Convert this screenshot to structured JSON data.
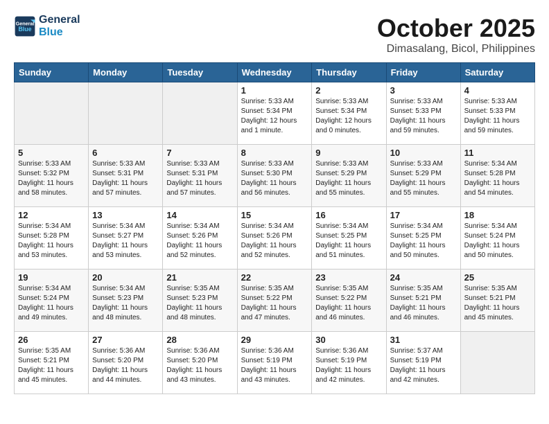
{
  "logo": {
    "line1": "General",
    "line2": "Blue"
  },
  "title": "October 2025",
  "subtitle": "Dimasalang, Bicol, Philippines",
  "days_of_week": [
    "Sunday",
    "Monday",
    "Tuesday",
    "Wednesday",
    "Thursday",
    "Friday",
    "Saturday"
  ],
  "weeks": [
    [
      {
        "day": "",
        "info": ""
      },
      {
        "day": "",
        "info": ""
      },
      {
        "day": "",
        "info": ""
      },
      {
        "day": "1",
        "info": "Sunrise: 5:33 AM\nSunset: 5:34 PM\nDaylight: 12 hours and 1 minute."
      },
      {
        "day": "2",
        "info": "Sunrise: 5:33 AM\nSunset: 5:34 PM\nDaylight: 12 hours and 0 minutes."
      },
      {
        "day": "3",
        "info": "Sunrise: 5:33 AM\nSunset: 5:33 PM\nDaylight: 11 hours and 59 minutes."
      },
      {
        "day": "4",
        "info": "Sunrise: 5:33 AM\nSunset: 5:33 PM\nDaylight: 11 hours and 59 minutes."
      }
    ],
    [
      {
        "day": "5",
        "info": "Sunrise: 5:33 AM\nSunset: 5:32 PM\nDaylight: 11 hours and 58 minutes."
      },
      {
        "day": "6",
        "info": "Sunrise: 5:33 AM\nSunset: 5:31 PM\nDaylight: 11 hours and 57 minutes."
      },
      {
        "day": "7",
        "info": "Sunrise: 5:33 AM\nSunset: 5:31 PM\nDaylight: 11 hours and 57 minutes."
      },
      {
        "day": "8",
        "info": "Sunrise: 5:33 AM\nSunset: 5:30 PM\nDaylight: 11 hours and 56 minutes."
      },
      {
        "day": "9",
        "info": "Sunrise: 5:33 AM\nSunset: 5:29 PM\nDaylight: 11 hours and 55 minutes."
      },
      {
        "day": "10",
        "info": "Sunrise: 5:33 AM\nSunset: 5:29 PM\nDaylight: 11 hours and 55 minutes."
      },
      {
        "day": "11",
        "info": "Sunrise: 5:34 AM\nSunset: 5:28 PM\nDaylight: 11 hours and 54 minutes."
      }
    ],
    [
      {
        "day": "12",
        "info": "Sunrise: 5:34 AM\nSunset: 5:28 PM\nDaylight: 11 hours and 53 minutes."
      },
      {
        "day": "13",
        "info": "Sunrise: 5:34 AM\nSunset: 5:27 PM\nDaylight: 11 hours and 53 minutes."
      },
      {
        "day": "14",
        "info": "Sunrise: 5:34 AM\nSunset: 5:26 PM\nDaylight: 11 hours and 52 minutes."
      },
      {
        "day": "15",
        "info": "Sunrise: 5:34 AM\nSunset: 5:26 PM\nDaylight: 11 hours and 52 minutes."
      },
      {
        "day": "16",
        "info": "Sunrise: 5:34 AM\nSunset: 5:25 PM\nDaylight: 11 hours and 51 minutes."
      },
      {
        "day": "17",
        "info": "Sunrise: 5:34 AM\nSunset: 5:25 PM\nDaylight: 11 hours and 50 minutes."
      },
      {
        "day": "18",
        "info": "Sunrise: 5:34 AM\nSunset: 5:24 PM\nDaylight: 11 hours and 50 minutes."
      }
    ],
    [
      {
        "day": "19",
        "info": "Sunrise: 5:34 AM\nSunset: 5:24 PM\nDaylight: 11 hours and 49 minutes."
      },
      {
        "day": "20",
        "info": "Sunrise: 5:34 AM\nSunset: 5:23 PM\nDaylight: 11 hours and 48 minutes."
      },
      {
        "day": "21",
        "info": "Sunrise: 5:35 AM\nSunset: 5:23 PM\nDaylight: 11 hours and 48 minutes."
      },
      {
        "day": "22",
        "info": "Sunrise: 5:35 AM\nSunset: 5:22 PM\nDaylight: 11 hours and 47 minutes."
      },
      {
        "day": "23",
        "info": "Sunrise: 5:35 AM\nSunset: 5:22 PM\nDaylight: 11 hours and 46 minutes."
      },
      {
        "day": "24",
        "info": "Sunrise: 5:35 AM\nSunset: 5:21 PM\nDaylight: 11 hours and 46 minutes."
      },
      {
        "day": "25",
        "info": "Sunrise: 5:35 AM\nSunset: 5:21 PM\nDaylight: 11 hours and 45 minutes."
      }
    ],
    [
      {
        "day": "26",
        "info": "Sunrise: 5:35 AM\nSunset: 5:21 PM\nDaylight: 11 hours and 45 minutes."
      },
      {
        "day": "27",
        "info": "Sunrise: 5:36 AM\nSunset: 5:20 PM\nDaylight: 11 hours and 44 minutes."
      },
      {
        "day": "28",
        "info": "Sunrise: 5:36 AM\nSunset: 5:20 PM\nDaylight: 11 hours and 43 minutes."
      },
      {
        "day": "29",
        "info": "Sunrise: 5:36 AM\nSunset: 5:19 PM\nDaylight: 11 hours and 43 minutes."
      },
      {
        "day": "30",
        "info": "Sunrise: 5:36 AM\nSunset: 5:19 PM\nDaylight: 11 hours and 42 minutes."
      },
      {
        "day": "31",
        "info": "Sunrise: 5:37 AM\nSunset: 5:19 PM\nDaylight: 11 hours and 42 minutes."
      },
      {
        "day": "",
        "info": ""
      }
    ]
  ]
}
